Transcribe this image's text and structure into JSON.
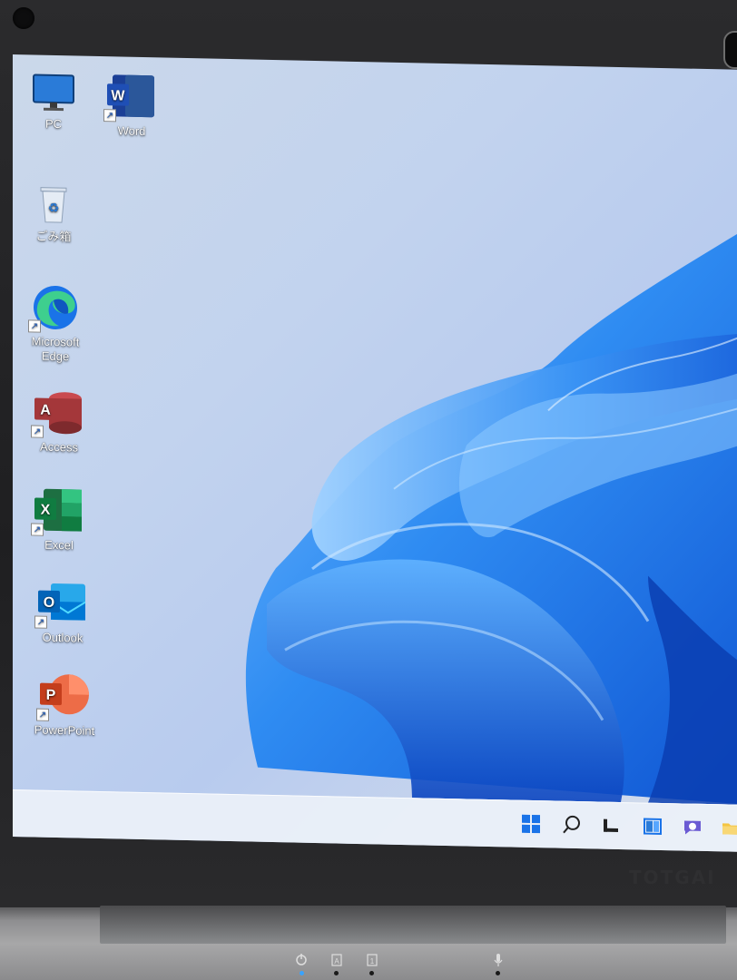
{
  "desktop": {
    "icons": [
      {
        "label": "PC",
        "icon": "monitor-icon"
      },
      {
        "label": "Word",
        "icon": "word-icon",
        "letter": "W"
      },
      {
        "label": "ごみ箱",
        "icon": "recycle-bin-icon"
      },
      {
        "label": "Microsoft Edge",
        "icon": "edge-icon"
      },
      {
        "label": "Access",
        "icon": "access-icon",
        "letter": "A"
      },
      {
        "label": "Excel",
        "icon": "excel-icon",
        "letter": "X"
      },
      {
        "label": "Outlook",
        "icon": "outlook-icon",
        "letter": "O"
      },
      {
        "label": "PowerPoint",
        "icon": "powerpoint-icon",
        "letter": "P"
      }
    ],
    "wallpaper": "windows-11-bloom",
    "colors": {
      "accent": "#1a73e8",
      "word": "#2b579a",
      "access": "#a4373a",
      "excel": "#217346",
      "outlook": "#0072c6",
      "powerpoint": "#d24726"
    }
  },
  "taskbar": {
    "icons": [
      "start-icon",
      "search-icon",
      "task-view-icon",
      "widgets-icon",
      "chat-icon",
      "file-explorer-icon"
    ]
  },
  "laptop": {
    "brand": "TOTGAI",
    "indicators": [
      "power-icon",
      "caps-lock-icon",
      "num-lock-icon",
      "microphone-icon"
    ]
  }
}
